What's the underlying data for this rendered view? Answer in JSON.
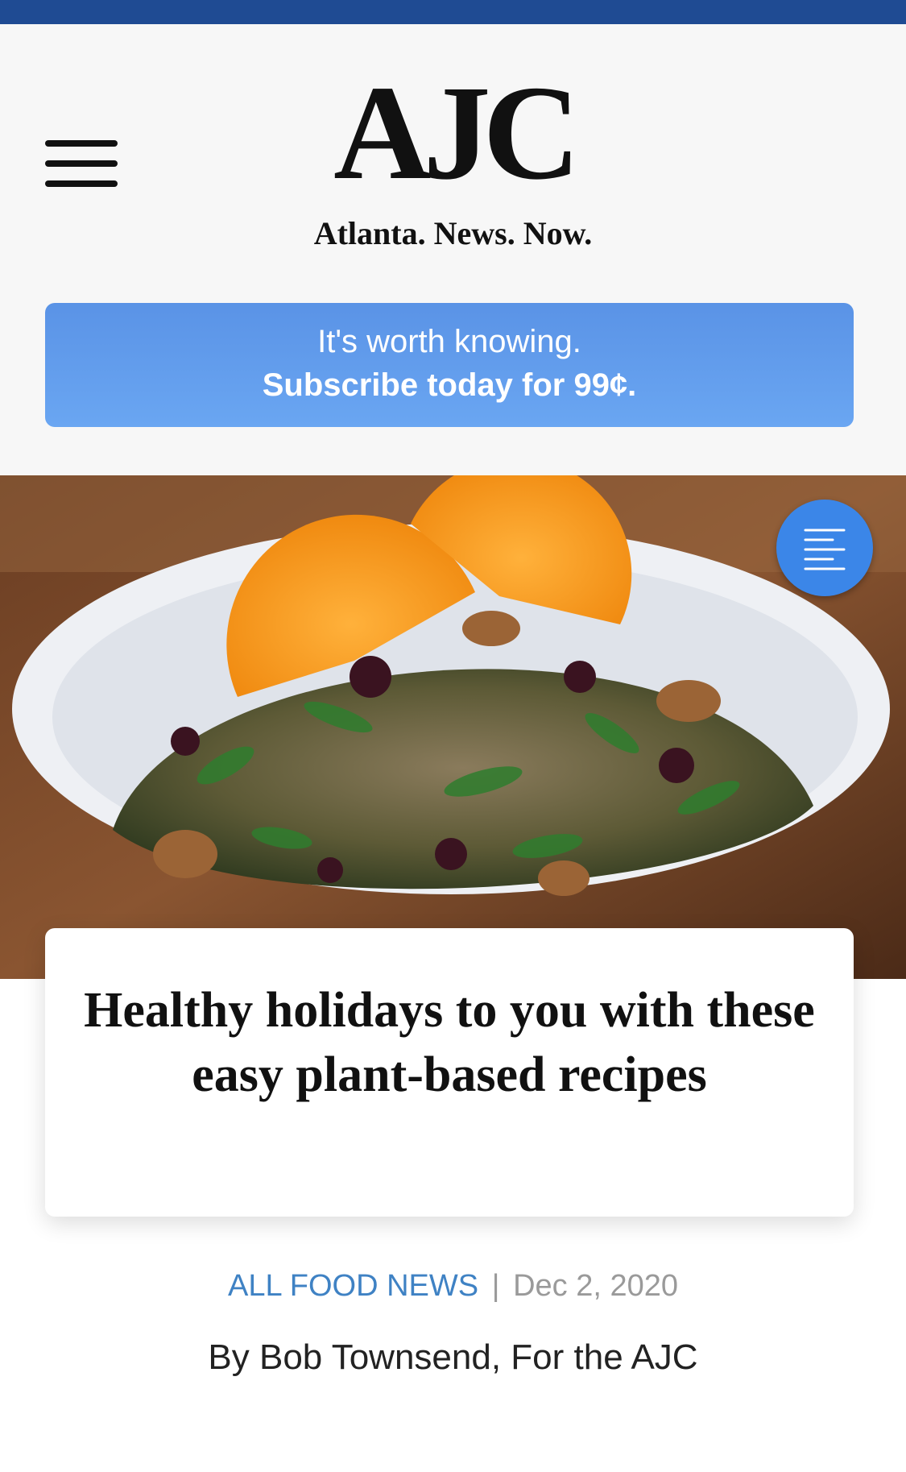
{
  "header": {
    "logo": "AJC",
    "tagline": "Atlanta. News. Now."
  },
  "subscribe": {
    "line1": "It's worth knowing.",
    "line2": "Subscribe today for 99¢."
  },
  "hero": {
    "image_icon": "salad-bowl-photo"
  },
  "toc_button": {
    "icon": "text-align-left-icon"
  },
  "article": {
    "headline": "Healthy holidays to you with these easy plant-based recipes",
    "section": "ALL FOOD NEWS",
    "separator": "|",
    "date": "Dec 2, 2020",
    "byline": "By Bob Townsend, For the AJC"
  },
  "colors": {
    "top_strip": "#1f4b93",
    "subscribe_bg": "#5a93e6",
    "accent_blue": "#3f82c4",
    "toc_button": "#3b86e8"
  }
}
